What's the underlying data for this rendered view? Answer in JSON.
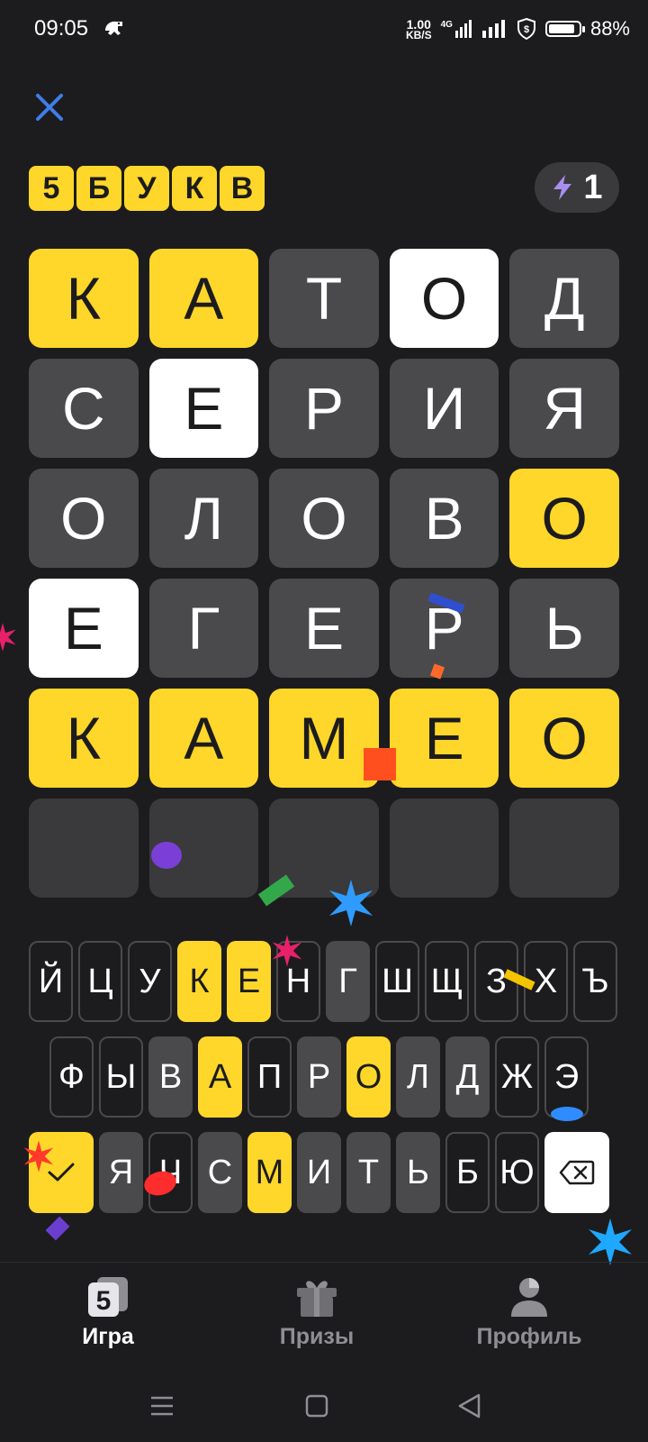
{
  "status_bar": {
    "time": "09:05",
    "net_speed_value": "1.00",
    "net_speed_unit": "KB/S",
    "network": "4G",
    "battery_percent": "88%",
    "battery_level": 0.88
  },
  "header": {
    "title_letters": [
      "5",
      "Б",
      "У",
      "К",
      "В"
    ],
    "energy_count": "1"
  },
  "colors": {
    "yellow": "#ffd72a",
    "white": "#ffffff",
    "gray": "#4a4a4c",
    "empty": "#3a3a3c",
    "background": "#1c1c1e"
  },
  "board": {
    "rows": [
      [
        {
          "l": "К",
          "s": "yellow"
        },
        {
          "l": "А",
          "s": "yellow"
        },
        {
          "l": "Т",
          "s": "gray"
        },
        {
          "l": "О",
          "s": "white"
        },
        {
          "l": "Д",
          "s": "gray"
        }
      ],
      [
        {
          "l": "С",
          "s": "gray"
        },
        {
          "l": "Е",
          "s": "white"
        },
        {
          "l": "Р",
          "s": "gray"
        },
        {
          "l": "И",
          "s": "gray"
        },
        {
          "l": "Я",
          "s": "gray"
        }
      ],
      [
        {
          "l": "О",
          "s": "gray"
        },
        {
          "l": "Л",
          "s": "gray"
        },
        {
          "l": "О",
          "s": "gray"
        },
        {
          "l": "В",
          "s": "gray"
        },
        {
          "l": "О",
          "s": "yellow"
        }
      ],
      [
        {
          "l": "Е",
          "s": "white"
        },
        {
          "l": "Г",
          "s": "gray"
        },
        {
          "l": "Е",
          "s": "gray"
        },
        {
          "l": "Р",
          "s": "gray"
        },
        {
          "l": "Ь",
          "s": "gray"
        }
      ],
      [
        {
          "l": "К",
          "s": "yellow"
        },
        {
          "l": "А",
          "s": "yellow"
        },
        {
          "l": "М",
          "s": "yellow"
        },
        {
          "l": "Е",
          "s": "yellow"
        },
        {
          "l": "О",
          "s": "yellow"
        }
      ],
      [
        {
          "l": "",
          "s": "empty"
        },
        {
          "l": "",
          "s": "empty"
        },
        {
          "l": "",
          "s": "empty"
        },
        {
          "l": "",
          "s": "empty"
        },
        {
          "l": "",
          "s": "empty"
        }
      ]
    ]
  },
  "keyboard": {
    "row1": [
      {
        "k": "Й",
        "s": "unused"
      },
      {
        "k": "Ц",
        "s": "unused"
      },
      {
        "k": "У",
        "s": "unused"
      },
      {
        "k": "К",
        "s": "yellow"
      },
      {
        "k": "Е",
        "s": "yellow"
      },
      {
        "k": "Н",
        "s": "unused"
      },
      {
        "k": "Г",
        "s": "gray"
      },
      {
        "k": "Ш",
        "s": "unused"
      },
      {
        "k": "Щ",
        "s": "unused"
      },
      {
        "k": "З",
        "s": "unused"
      },
      {
        "k": "Х",
        "s": "unused"
      },
      {
        "k": "Ъ",
        "s": "unused"
      }
    ],
    "row2": [
      {
        "k": "Ф",
        "s": "unused"
      },
      {
        "k": "Ы",
        "s": "unused"
      },
      {
        "k": "В",
        "s": "gray"
      },
      {
        "k": "А",
        "s": "yellow"
      },
      {
        "k": "П",
        "s": "unused"
      },
      {
        "k": "Р",
        "s": "gray"
      },
      {
        "k": "О",
        "s": "yellow"
      },
      {
        "k": "Л",
        "s": "gray"
      },
      {
        "k": "Д",
        "s": "gray"
      },
      {
        "k": "Ж",
        "s": "unused"
      },
      {
        "k": "Э",
        "s": "unused"
      }
    ],
    "row3": [
      {
        "k": "Я",
        "s": "gray"
      },
      {
        "k": "Ч",
        "s": "unused"
      },
      {
        "k": "С",
        "s": "gray"
      },
      {
        "k": "М",
        "s": "yellow"
      },
      {
        "k": "И",
        "s": "gray"
      },
      {
        "k": "Т",
        "s": "gray"
      },
      {
        "k": "Ь",
        "s": "gray"
      },
      {
        "k": "Б",
        "s": "unused"
      },
      {
        "k": "Ю",
        "s": "unused"
      }
    ],
    "enter_icon": "check-icon",
    "backspace_icon": "backspace-icon"
  },
  "bottom_nav": {
    "items": [
      {
        "label": "Игра",
        "icon": "game-5-icon",
        "active": true
      },
      {
        "label": "Призы",
        "icon": "gift-icon",
        "active": false
      },
      {
        "label": "Профиль",
        "icon": "profile-icon",
        "active": false
      }
    ]
  },
  "system_nav": {
    "icons": [
      "menu-icon",
      "home-icon",
      "back-icon"
    ]
  }
}
